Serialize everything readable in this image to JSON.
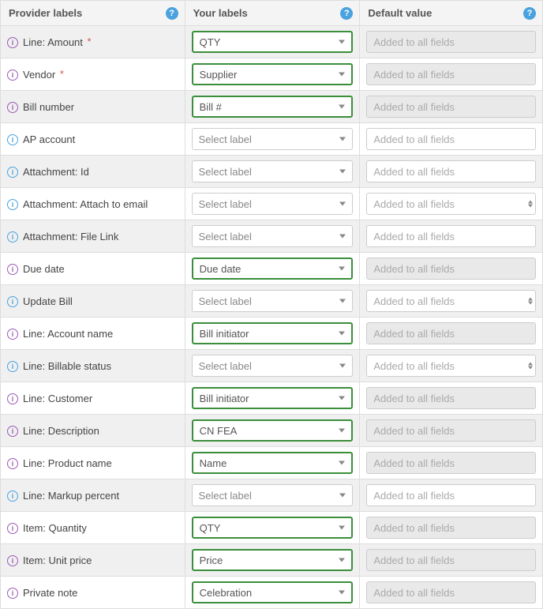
{
  "headers": {
    "provider": "Provider labels",
    "yourlabels": "Your labels",
    "default": "Default value"
  },
  "placeholders": {
    "select": "Select label",
    "default": "Added to all fields"
  },
  "rows": [
    {
      "label": "Line: Amount",
      "icon": "purple",
      "required": true,
      "value": "QTY",
      "filled": true,
      "defaultEnabled": false,
      "defaultType": "text"
    },
    {
      "label": "Vendor",
      "icon": "purple",
      "required": true,
      "value": "Supplier",
      "filled": true,
      "defaultEnabled": false,
      "defaultType": "text"
    },
    {
      "label": "Bill number",
      "icon": "purple",
      "required": false,
      "value": "Bill #",
      "filled": true,
      "defaultEnabled": false,
      "defaultType": "text"
    },
    {
      "label": "AP account",
      "icon": "blue",
      "required": false,
      "value": "",
      "filled": false,
      "defaultEnabled": true,
      "defaultType": "text"
    },
    {
      "label": "Attachment: Id",
      "icon": "blue",
      "required": false,
      "value": "",
      "filled": false,
      "defaultEnabled": true,
      "defaultType": "text"
    },
    {
      "label": "Attachment: Attach to email",
      "icon": "blue",
      "required": false,
      "value": "",
      "filled": false,
      "defaultEnabled": true,
      "defaultType": "select"
    },
    {
      "label": "Attachment: File Link",
      "icon": "blue",
      "required": false,
      "value": "",
      "filled": false,
      "defaultEnabled": true,
      "defaultType": "text"
    },
    {
      "label": "Due date",
      "icon": "purple",
      "required": false,
      "value": "Due date",
      "filled": true,
      "defaultEnabled": false,
      "defaultType": "text"
    },
    {
      "label": "Update Bill",
      "icon": "blue",
      "required": false,
      "value": "",
      "filled": false,
      "defaultEnabled": true,
      "defaultType": "select"
    },
    {
      "label": "Line: Account name",
      "icon": "purple",
      "required": false,
      "value": "Bill initiator",
      "filled": true,
      "defaultEnabled": false,
      "defaultType": "text"
    },
    {
      "label": "Line: Billable status",
      "icon": "blue",
      "required": false,
      "value": "",
      "filled": false,
      "defaultEnabled": true,
      "defaultType": "select"
    },
    {
      "label": "Line: Customer",
      "icon": "purple",
      "required": false,
      "value": "Bill initiator",
      "filled": true,
      "defaultEnabled": false,
      "defaultType": "text"
    },
    {
      "label": "Line: Description",
      "icon": "purple",
      "required": false,
      "value": "CN FEA",
      "filled": true,
      "defaultEnabled": false,
      "defaultType": "text"
    },
    {
      "label": "Line: Product name",
      "icon": "purple",
      "required": false,
      "value": "Name",
      "filled": true,
      "defaultEnabled": false,
      "defaultType": "text"
    },
    {
      "label": "Line: Markup percent",
      "icon": "blue",
      "required": false,
      "value": "",
      "filled": false,
      "defaultEnabled": true,
      "defaultType": "text"
    },
    {
      "label": "Item: Quantity",
      "icon": "purple",
      "required": false,
      "value": "QTY",
      "filled": true,
      "defaultEnabled": false,
      "defaultType": "text"
    },
    {
      "label": "Item: Unit price",
      "icon": "purple",
      "required": false,
      "value": "Price",
      "filled": true,
      "defaultEnabled": false,
      "defaultType": "text"
    },
    {
      "label": "Private note",
      "icon": "purple",
      "required": false,
      "value": "Celebration",
      "filled": true,
      "defaultEnabled": false,
      "defaultType": "text"
    }
  ]
}
